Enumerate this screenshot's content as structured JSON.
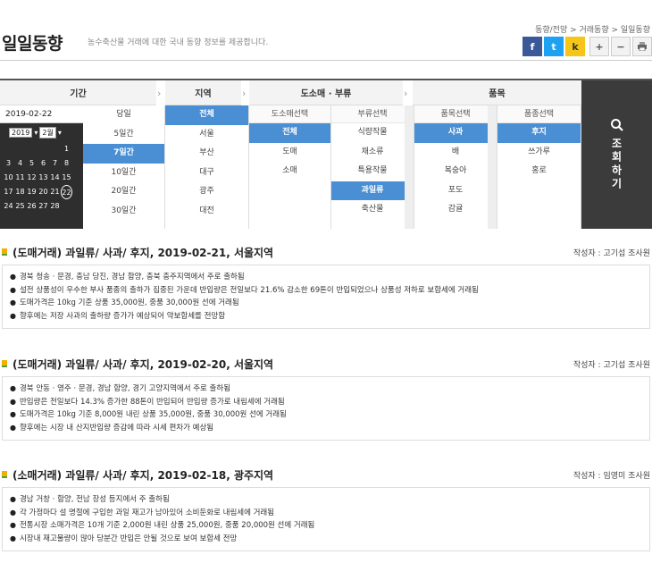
{
  "header": {
    "title": "일일동향",
    "subtitle": "농수축산물 거래에 대한 국내 동향 정보를 제공합니다.",
    "breadcrumb": "동향/전망 > 거래동향 > 일일동향",
    "tools": [
      "f",
      "t",
      "k",
      "+",
      "−",
      "print-icon"
    ]
  },
  "filters": {
    "headers": {
      "period": "기간",
      "region": "지역",
      "market": "도소매 · 부류",
      "item": "품목"
    },
    "date": "2019-02-22",
    "calendar": {
      "year": "2019",
      "month": "2월",
      "days": [
        "",
        "",
        "",
        "",
        "",
        "1",
        "",
        "3",
        "4",
        "5",
        "6",
        "7",
        "8",
        "",
        "10",
        "11",
        "12",
        "13",
        "14",
        "15",
        "",
        "17",
        "18",
        "19",
        "20",
        "21",
        "22",
        "",
        "24",
        "25",
        "26",
        "27",
        "28",
        "",
        ""
      ]
    },
    "periods": [
      "당일",
      "5일간",
      "7일간",
      "10일간",
      "20일간",
      "30일간"
    ],
    "periods_selected": "7일간",
    "regions": [
      "전체",
      "서울",
      "부산",
      "대구",
      "광주",
      "대전"
    ],
    "regions_selected": "전체",
    "market_header": "도소매선택",
    "markets": [
      "전체",
      "도매",
      "소매"
    ],
    "markets_selected": "전체",
    "category_header": "부류선택",
    "categories": [
      "식량작물",
      "채소류",
      "특용작물",
      "과일류",
      "축산물"
    ],
    "categories_selected": "과일류",
    "item_header": "품목선택",
    "items": [
      "사과",
      "배",
      "복숭아",
      "포도",
      "감귤"
    ],
    "items_selected": "사과",
    "variety_header": "품종선택",
    "varieties": [
      "후지",
      "쓰가루",
      "홍로"
    ],
    "varieties_selected": "후지",
    "search_button": "조회하기"
  },
  "articles": [
    {
      "title": "(도매거래) 과일류/ 사과/ 후지, 2019-02-21, 서울지역",
      "author": "작성자 : 고기섭 조사원",
      "lines": [
        "경북 청송 · 문경, 충남 당진, 경남 함양, 충북 충주지역에서 주로 출하됨",
        "설전 상품성이 우수한 부사 품종의 출하가 집중된 가운데 반입량은 전일보다 21.6% 감소한 69톤이 반입되었으나 상품성 저하로 보합세에 거래됨",
        "도매가격은 10kg 기준 상품 35,000원, 중품 30,000원 선에 거래됨",
        "향후에는 저장 사과의 출하량 증가가 예상되어 약보합세를 전망함"
      ]
    },
    {
      "title": "(도매거래) 과일류/ 사과/ 후지, 2019-02-20, 서울지역",
      "author": "작성자 : 고기섭 조사원",
      "lines": [
        "경북 안동 · 영주 · 문경, 경남 함양, 경기 고양지역에서 주로 출하됨",
        "반입량은 전일보다 14.3% 증가한 88톤이 반입되어 반입량 증가로 내림세에 거래됨",
        "도매가격은 10kg 기준 8,000원 내린 상품 35,000원, 중품 30,000원 선에 거래됨",
        "향후에는 시장 내 산지반입량 증감에 따라 시세 편차가 예상됨"
      ]
    },
    {
      "title": "(소매거래) 과일류/ 사과/ 후지, 2019-02-18, 광주지역",
      "author": "작성자 : 임영미 조사원",
      "lines": [
        "경남 거창 · 함양, 전남 장성 등지에서 주 출하됨",
        "각 가정마다 설 명절에 구입한 과일 재고가 남아있어 소비둔화로 내림세에 거래됨",
        "전통시장 소매가격은 10개 기준 2,000원 내린 상품 25,000원, 중품 20,000원 선에 거래됨",
        "시장내 재고물량이 많아 당분간 반입은 안될 것으로 보여 보합세 전망"
      ]
    }
  ]
}
